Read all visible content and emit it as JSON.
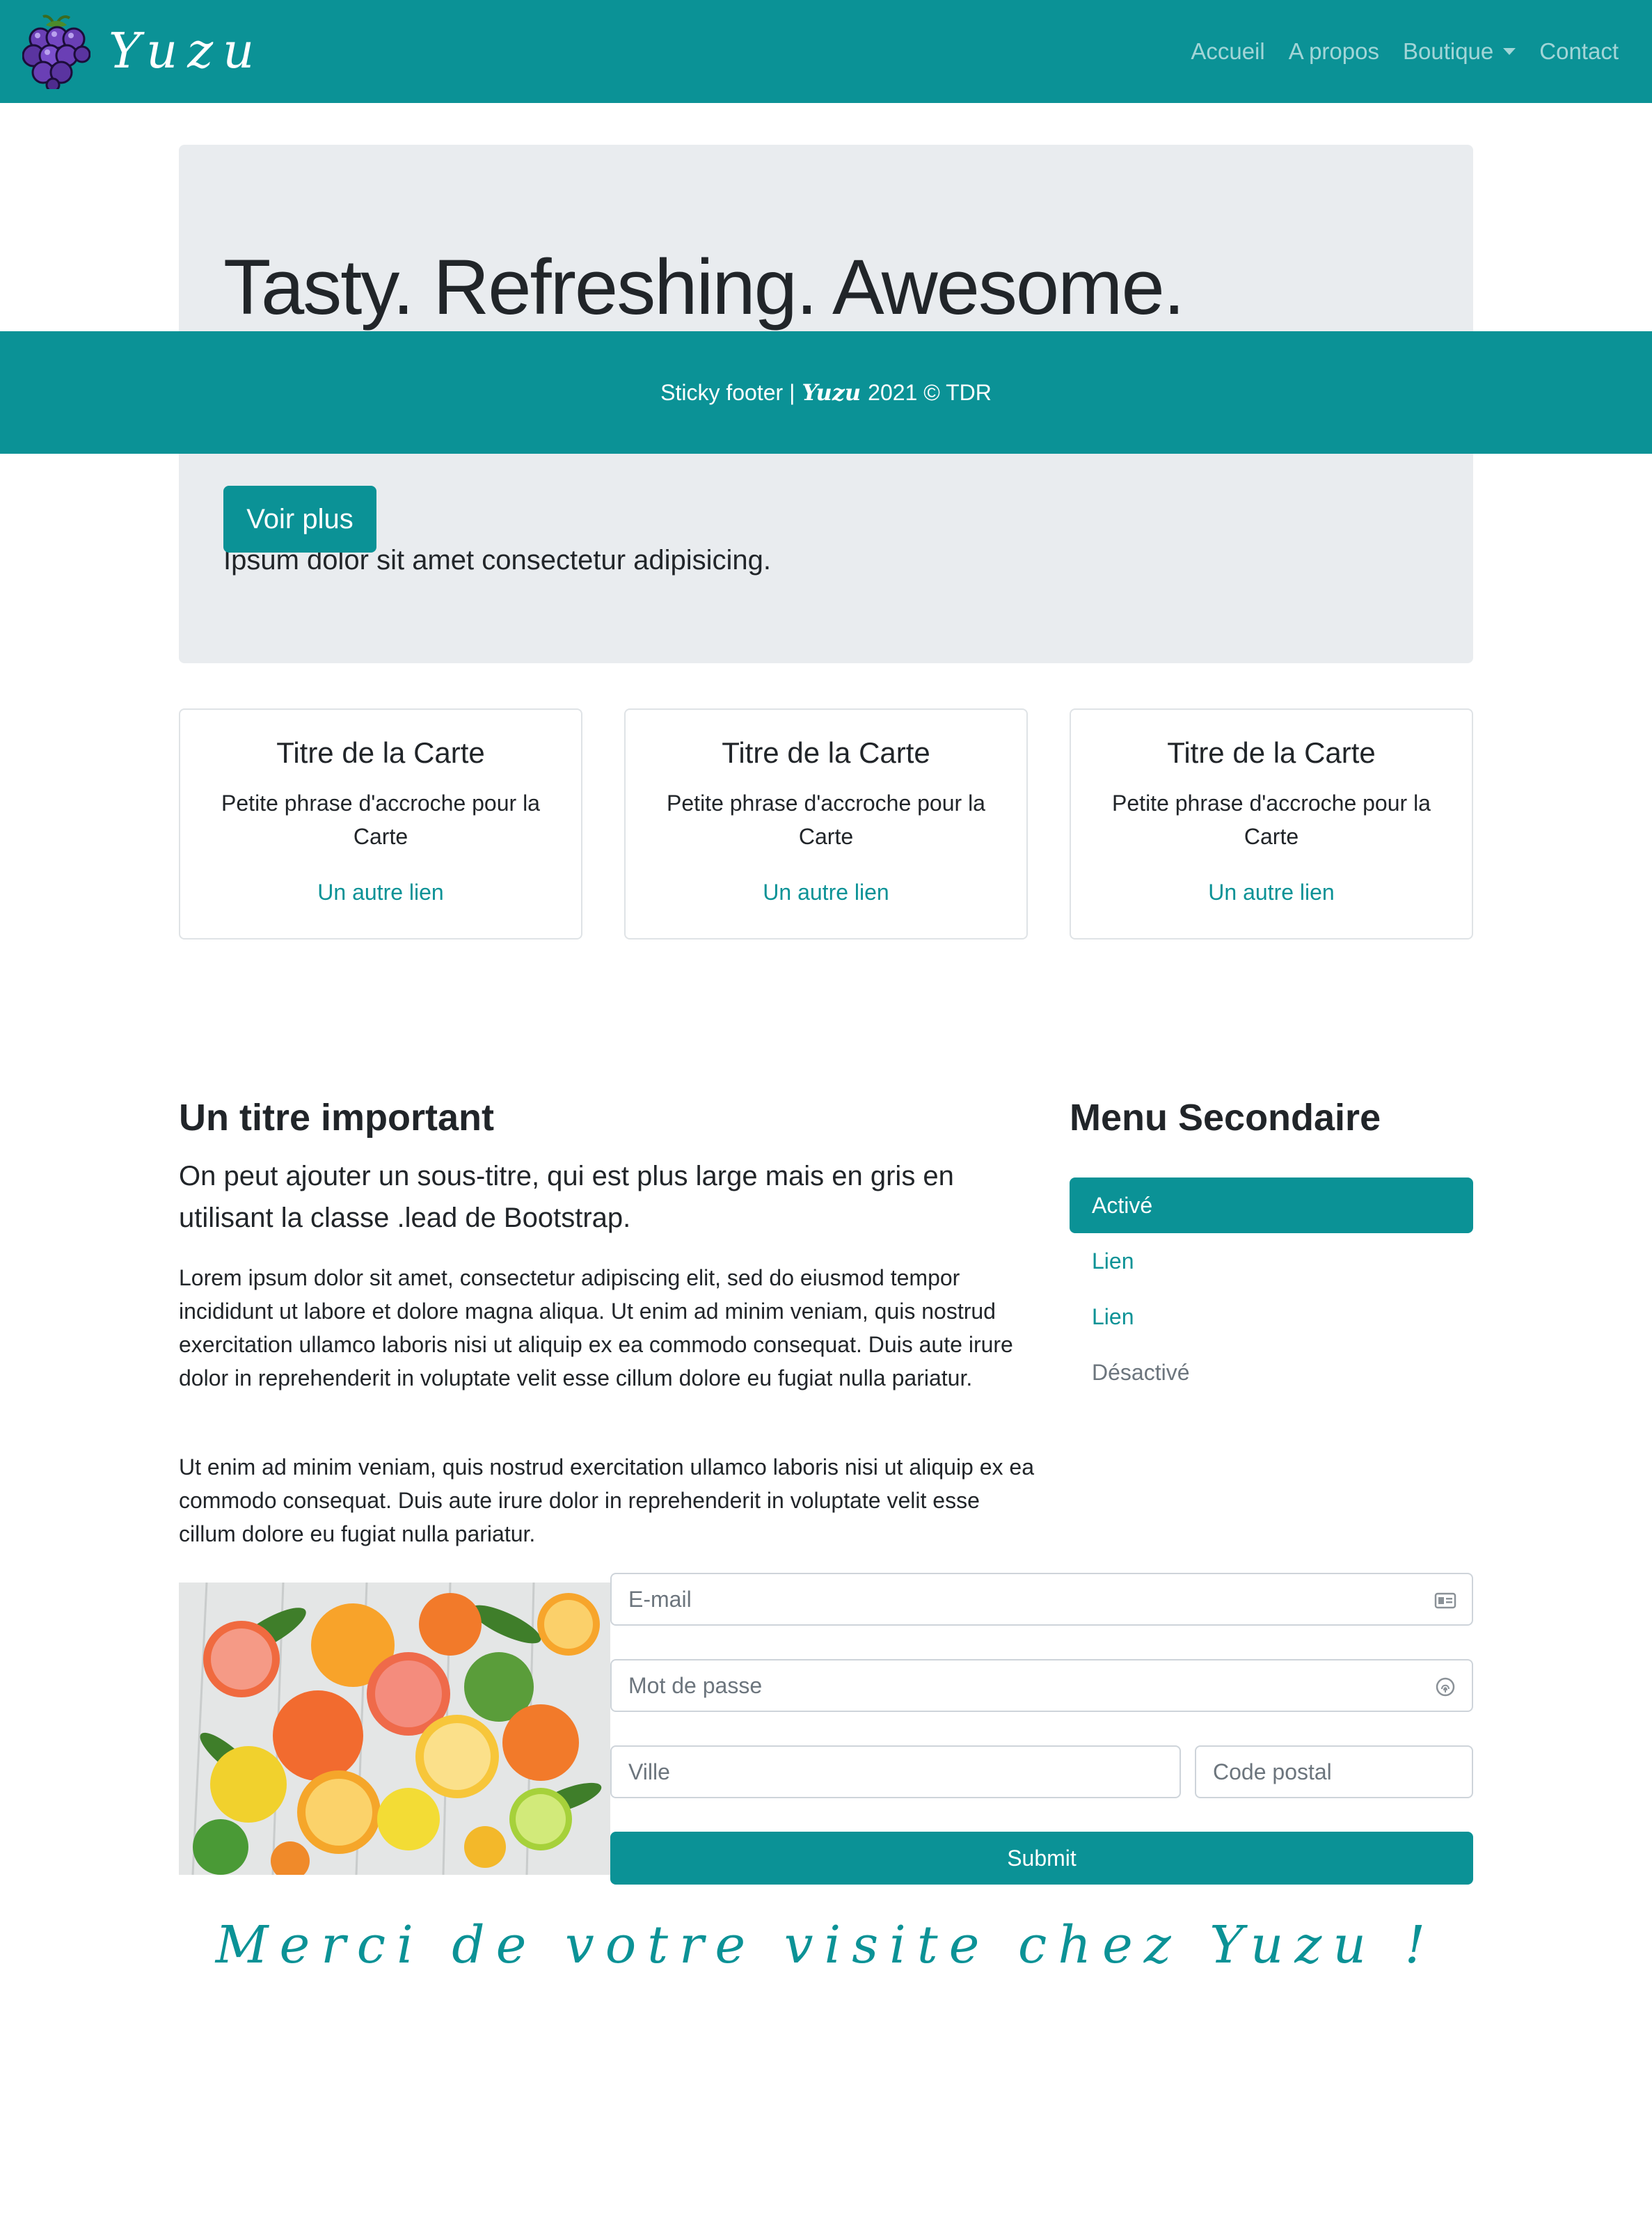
{
  "navbar": {
    "brand_name": "Yuzu",
    "logo_icon": "grapes-icon",
    "links": [
      "Accueil",
      "A propos",
      "Boutique",
      "Contact"
    ],
    "background_color": "#0b9296"
  },
  "hero": {
    "title": "Tasty. Refreshing. Awesome.",
    "lead": "Ipsum dolor sit amet consectetur adipisicing.",
    "button_label": "Voir plus"
  },
  "sticky_footer": {
    "prefix": "Sticky footer |",
    "brand": "Yuzu",
    "suffix": "2021 © TDR"
  },
  "cards": [
    {
      "title": "Titre de la Carte",
      "text": "Petite phrase d'accroche pour la Carte",
      "link": "Un autre lien"
    },
    {
      "title": "Titre de la Carte",
      "text": "Petite phrase d'accroche pour la Carte",
      "link": "Un autre lien"
    },
    {
      "title": "Titre de la Carte",
      "text": "Petite phrase d'accroche pour la Carte",
      "link": "Un autre lien"
    }
  ],
  "article": {
    "title": "Un titre important",
    "lead": "On peut ajouter un sous-titre, qui est plus large mais en gris en utilisant la classe .lead de Bootstrap.",
    "paragraph1": "Lorem ipsum dolor sit amet, consectetur adipiscing elit, sed do eiusmod tempor incididunt ut labore et dolore magna aliqua. Ut enim ad minim veniam, quis nostrud exercitation ullamco laboris nisi ut aliquip ex ea commodo consequat. Duis aute irure dolor in reprehenderit in voluptate velit esse cillum dolore eu fugiat nulla pariatur.",
    "paragraph2": "Ut enim ad minim veniam, quis nostrud exercitation ullamco laboris nisi ut aliquip ex ea commodo consequat. Duis aute irure dolor in reprehenderit in voluptate velit esse cillum dolore eu fugiat nulla pariatur."
  },
  "secondary_menu": {
    "title": "Menu Secondaire",
    "items": [
      {
        "label": "Activé",
        "state": "active"
      },
      {
        "label": "Lien",
        "state": "link"
      },
      {
        "label": "Lien",
        "state": "link"
      },
      {
        "label": "Désactivé",
        "state": "disabled"
      }
    ]
  },
  "form": {
    "email_placeholder": "E-mail",
    "password_placeholder": "Mot de passe",
    "city_placeholder": "Ville",
    "postal_placeholder": "Code postal",
    "submit_label": "Submit",
    "email_icon": "id-card-icon",
    "password_icon": "fingerprint-icon"
  },
  "thanks": "Merci de votre visite chez Yuzu !"
}
